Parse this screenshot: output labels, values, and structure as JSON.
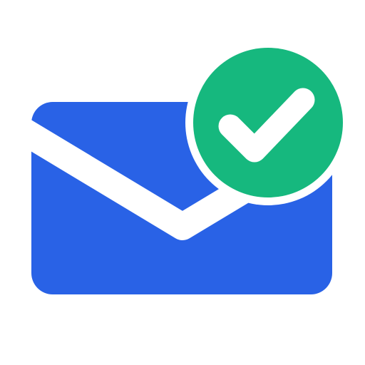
{
  "icon": {
    "name": "mail-verified-icon",
    "parts": [
      "envelope-icon",
      "checkmark-badge-icon"
    ]
  },
  "colors": {
    "background": "#ffffff",
    "envelope": "#2962E6",
    "envelope_flap": "#ffffff",
    "badge": "#16B87E",
    "check": "#ffffff"
  }
}
